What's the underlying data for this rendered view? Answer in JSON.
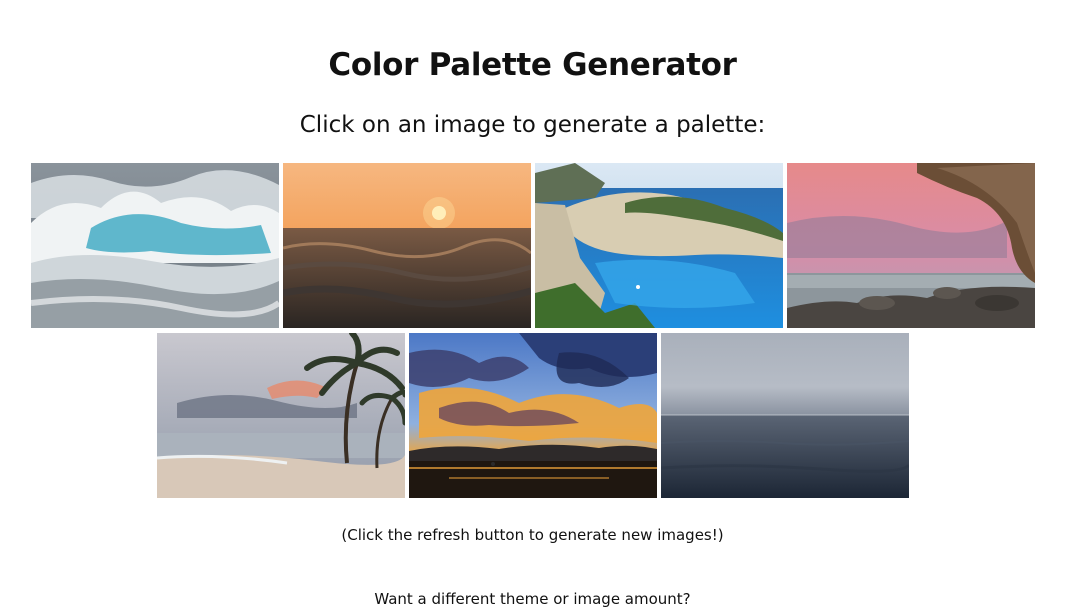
{
  "page": {
    "title": "Color Palette Generator",
    "subtitle": "Click on an image to generate a palette:",
    "refresh_note": "(Click the refresh button to generate new images!)",
    "theme_question": "Want a different theme or image amount?"
  },
  "images": [
    {
      "name": "ocean-waves-image",
      "colors": [
        "#6f7a84",
        "#e9eef0",
        "#5ab3c9"
      ]
    },
    {
      "name": "sea-sunset-image",
      "colors": [
        "#f29a4e",
        "#3b3430",
        "#ffe7a6"
      ]
    },
    {
      "name": "cliff-bay-image",
      "colors": [
        "#2f86c9",
        "#d8cdb2",
        "#3f6e2c"
      ]
    },
    {
      "name": "pink-sky-rocky-shore-image",
      "colors": [
        "#d98ca7",
        "#4a4541",
        "#8a6b52"
      ]
    },
    {
      "name": "palm-beach-image",
      "colors": [
        "#8f98a8",
        "#d8c8b8",
        "#2f3a2a"
      ]
    },
    {
      "name": "dramatic-sunset-clouds-image",
      "colors": [
        "#f0a53a",
        "#2b3f78",
        "#1f1710"
      ]
    },
    {
      "name": "calm-grey-sea-image",
      "colors": [
        "#b6bcc6",
        "#4a5566",
        "#1c2635"
      ]
    }
  ]
}
